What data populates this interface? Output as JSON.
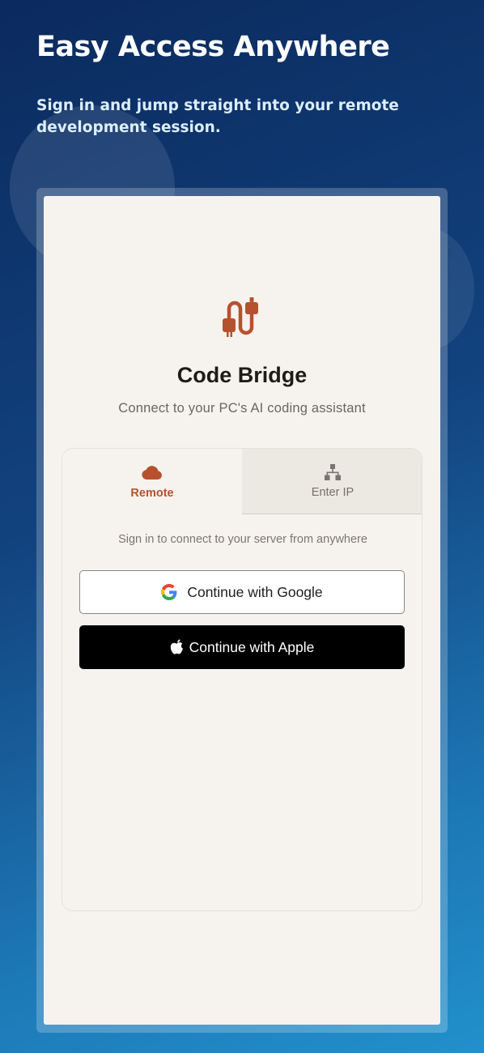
{
  "hero": {
    "title": "Easy Access Anywhere",
    "subtitle": "Sign in and jump straight into your remote development session."
  },
  "app": {
    "logo_icon": "cable-plug-icon",
    "title": "Code Bridge",
    "subtitle": "Connect to your PC's AI coding assistant"
  },
  "tabs": [
    {
      "label": "Remote",
      "icon": "cloud-icon",
      "active": true
    },
    {
      "label": "Enter IP",
      "icon": "network-icon",
      "active": false
    }
  ],
  "card": {
    "hint": "Sign in to connect to your server from anywhere",
    "google_label": "Continue with Google",
    "apple_label": "Continue with Apple"
  },
  "colors": {
    "accent": "#b6512f",
    "background_top": "#0b2a5e",
    "background_bottom": "#2190cc",
    "screen": "#f6f3ee"
  }
}
